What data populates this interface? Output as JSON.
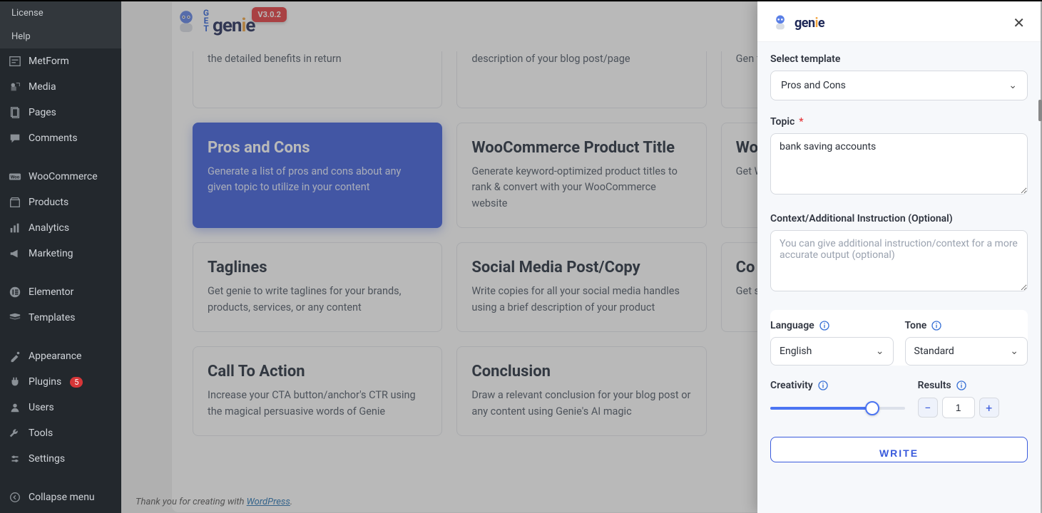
{
  "sidebar": {
    "top": [
      {
        "label": "License",
        "k": "license"
      },
      {
        "label": "Help",
        "k": "help"
      }
    ],
    "items": [
      {
        "label": "MetForm",
        "icon": "metform",
        "k": "metform"
      },
      {
        "label": "Media",
        "icon": "media",
        "k": "media"
      },
      {
        "label": "Pages",
        "icon": "pages",
        "k": "pages"
      },
      {
        "label": "Comments",
        "icon": "comments",
        "k": "comments"
      },
      {
        "label": "WooCommerce",
        "icon": "woo",
        "k": "woocommerce",
        "sep": true
      },
      {
        "label": "Products",
        "icon": "products",
        "k": "products"
      },
      {
        "label": "Analytics",
        "icon": "analytics",
        "k": "analytics"
      },
      {
        "label": "Marketing",
        "icon": "marketing",
        "k": "marketing"
      },
      {
        "label": "Elementor",
        "icon": "elementor",
        "k": "elementor",
        "sep": true
      },
      {
        "label": "Templates",
        "icon": "templates",
        "k": "templates"
      },
      {
        "label": "Appearance",
        "icon": "appearance",
        "k": "appearance",
        "sep": true
      },
      {
        "label": "Plugins",
        "icon": "plugins",
        "k": "plugins",
        "badge": "5"
      },
      {
        "label": "Users",
        "icon": "users",
        "k": "users"
      },
      {
        "label": "Tools",
        "icon": "tools",
        "k": "tools"
      },
      {
        "label": "Settings",
        "icon": "settings",
        "k": "settings"
      },
      {
        "label": "Collapse menu",
        "icon": "collapse",
        "k": "collapse",
        "sep": true
      }
    ]
  },
  "brand": {
    "name": "genie",
    "version": "V3.0.2"
  },
  "cards_row0": [
    {
      "k": "r0c0",
      "title": "",
      "desc": "the detailed benefits in return"
    },
    {
      "k": "r0c1",
      "title": "",
      "desc": "description of your blog post/page"
    },
    {
      "k": "r0c2",
      "title": "",
      "desc": "Gen\nfrien\nproc"
    }
  ],
  "cards": [
    {
      "k": "pros-cons",
      "title": "Pros and Cons",
      "desc": "Generate a list of pros and cons about any given topic to utilize in your content",
      "selected": true
    },
    {
      "k": "woo-title",
      "title": "WooCommerce Product Title",
      "desc": "Generate keyword-optimized product titles to rank & convert with your WooCommerce website"
    },
    {
      "k": "woo-descr",
      "title": "Wo\nDe",
      "desc": "Get\nWoo\ndesi"
    },
    {
      "k": "taglines",
      "title": "Taglines",
      "desc": "Get genie to write taglines for your brands, products, services, or any content"
    },
    {
      "k": "social",
      "title": "Social Media Post/Copy",
      "desc": "Write copies for all your social media handles using a brief description of your product"
    },
    {
      "k": "copywriting",
      "title": "Co",
      "desc": "Get\nsent"
    },
    {
      "k": "cta",
      "title": "Call To Action",
      "desc": "Increase your CTA button/anchor's CTR using the magical persuasive words of Genie"
    },
    {
      "k": "conclusion",
      "title": "Conclusion",
      "desc": "Draw a relevant conclusion for your blog post or any content using Genie's AI magic"
    }
  ],
  "footer": {
    "prefix": "Thank you for creating with ",
    "link": "WordPress",
    "suffix": "."
  },
  "drawer": {
    "template_label": "Select template",
    "template_value": "Pros and Cons",
    "topic_label": "Topic",
    "topic_value": "bank saving accounts",
    "context_label": "Context/Additional Instruction (Optional)",
    "context_placeholder": "You can give additional instruction/context for a more accurate output (optional)",
    "language_label": "Language",
    "language_value": "English",
    "tone_label": "Tone",
    "tone_value": "Standard",
    "creativity_label": "Creativity",
    "results_label": "Results",
    "results_value": "1",
    "write_label": "WRITE"
  }
}
